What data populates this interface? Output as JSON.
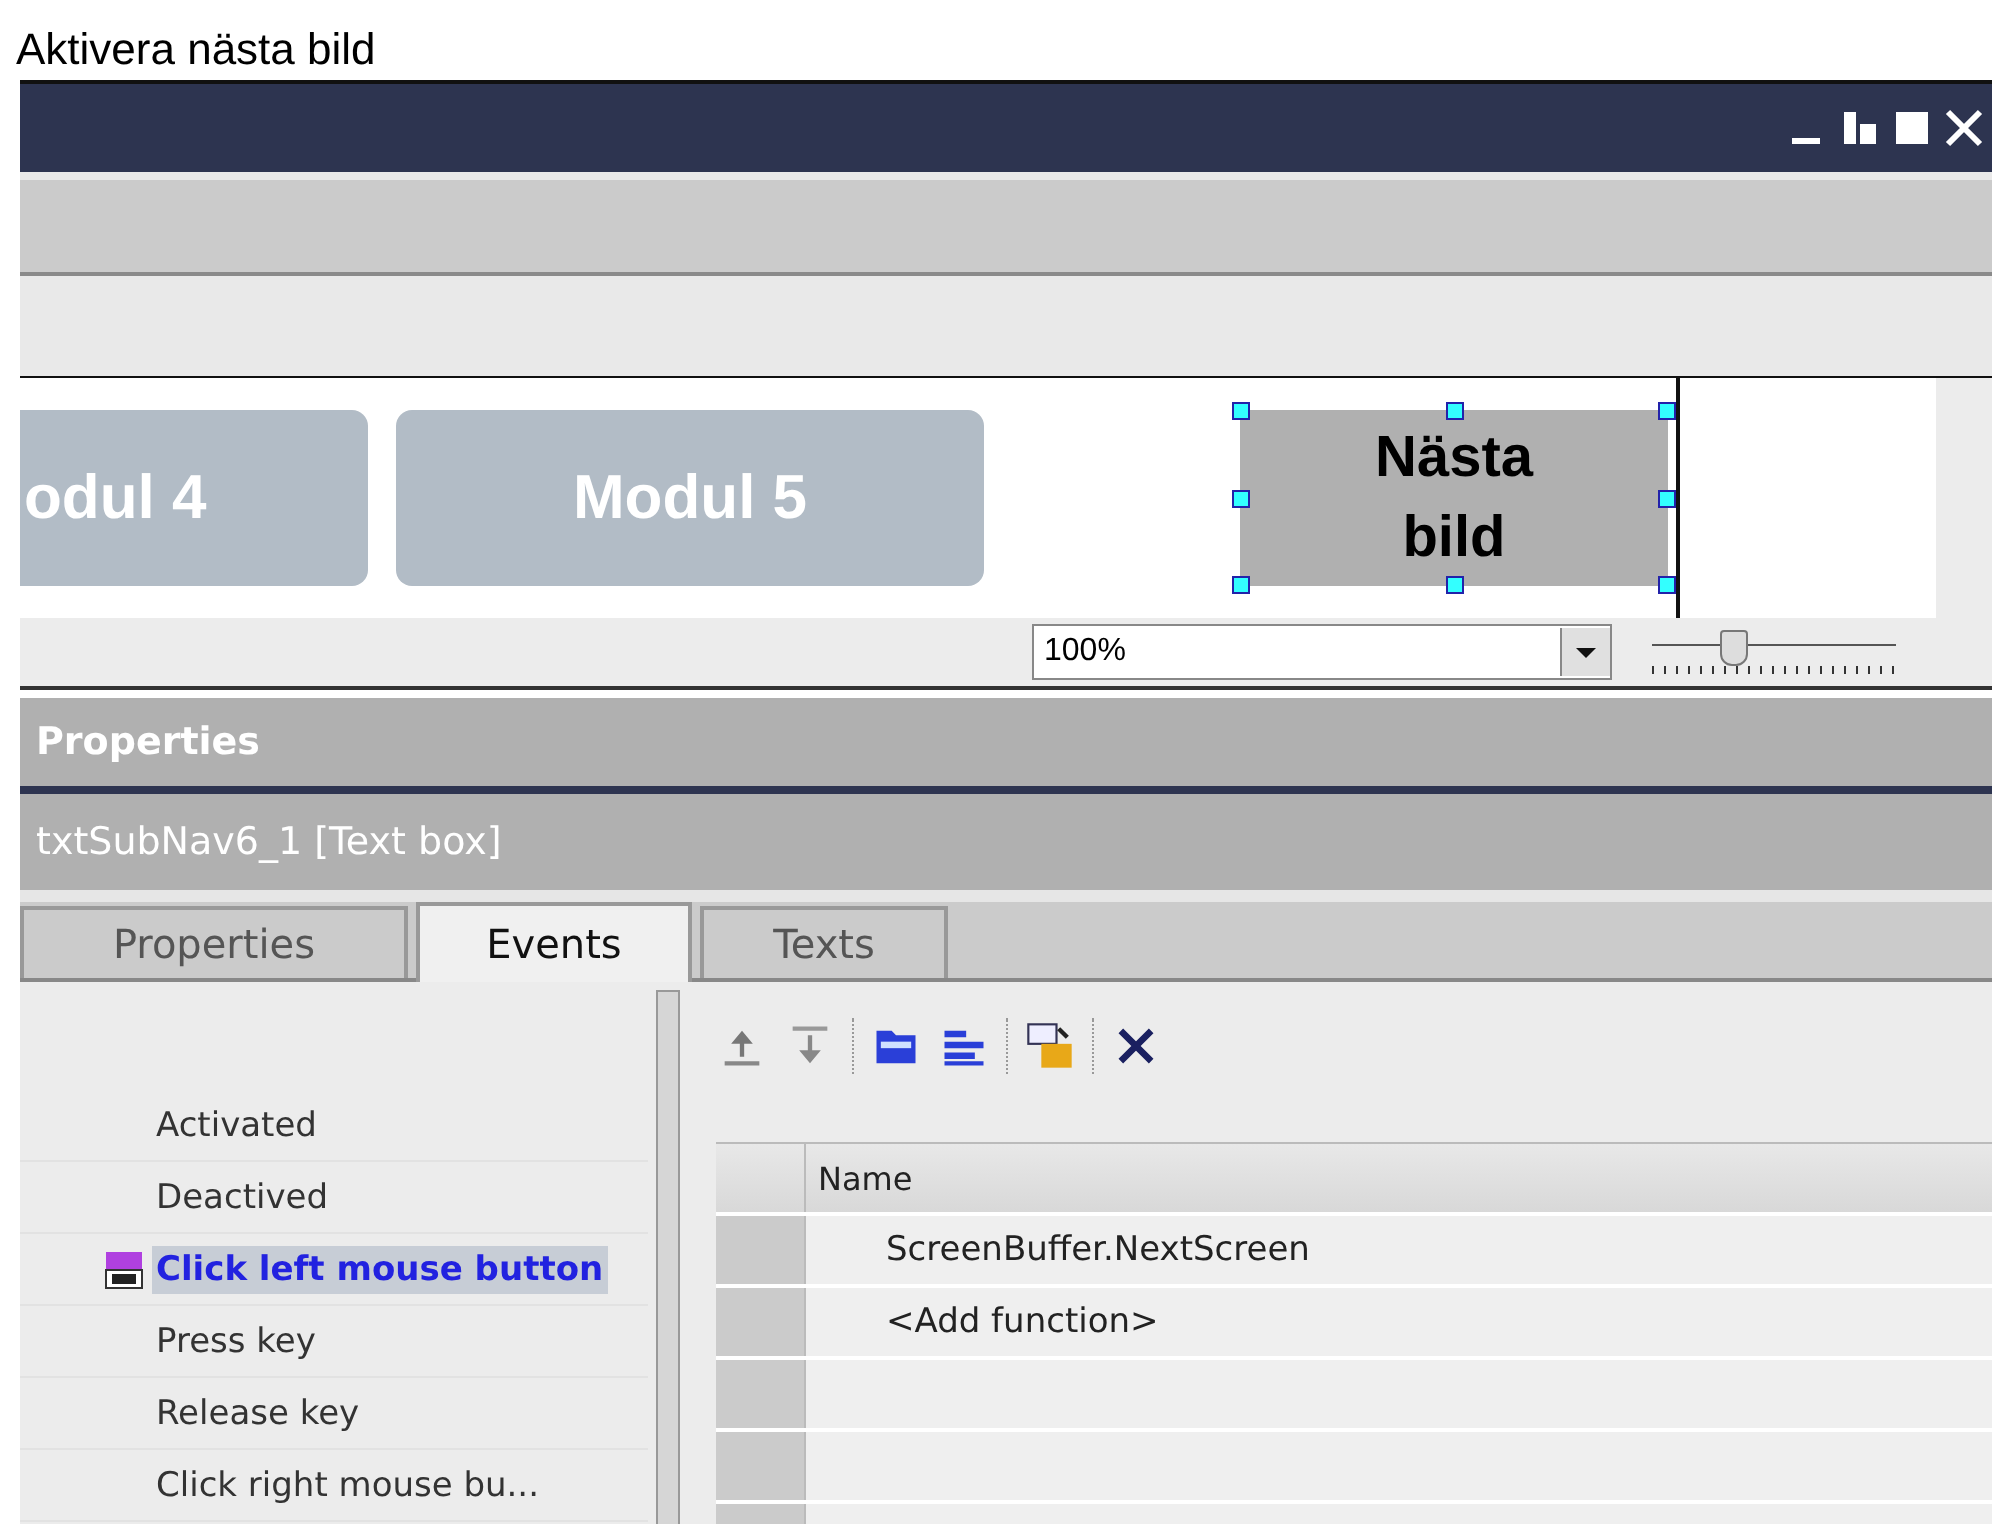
{
  "caption": "Aktivera nästa bild",
  "canvas": {
    "buttons": [
      {
        "label": "odul 4",
        "kind": "nav"
      },
      {
        "label": "Modul 5",
        "kind": "nav"
      },
      {
        "label": "Nästa bild",
        "kind": "selected-text-box"
      }
    ]
  },
  "zoom": {
    "value": "100%",
    "level": 0.33
  },
  "properties_panel": {
    "title": "Properties",
    "object": "txtSubNav6_1 [Text box]",
    "tabs": [
      {
        "label": "Properties",
        "selected": false
      },
      {
        "label": "Events",
        "selected": true
      },
      {
        "label": "Texts",
        "selected": false
      }
    ],
    "events": [
      {
        "label": "Activated",
        "selected": false,
        "function_assigned": false
      },
      {
        "label": "Deactived",
        "selected": false,
        "function_assigned": false
      },
      {
        "label": "Click left mouse button",
        "selected": true,
        "function_assigned": true
      },
      {
        "label": "Press key",
        "selected": false,
        "function_assigned": false
      },
      {
        "label": "Release key",
        "selected": false,
        "function_assigned": false
      },
      {
        "label": "Click right mouse bu...",
        "selected": false,
        "function_assigned": false
      }
    ],
    "function_table": {
      "columns": [
        "Name"
      ],
      "rows": [
        "ScreenBuffer.NextScreen",
        "<Add function>"
      ]
    }
  }
}
